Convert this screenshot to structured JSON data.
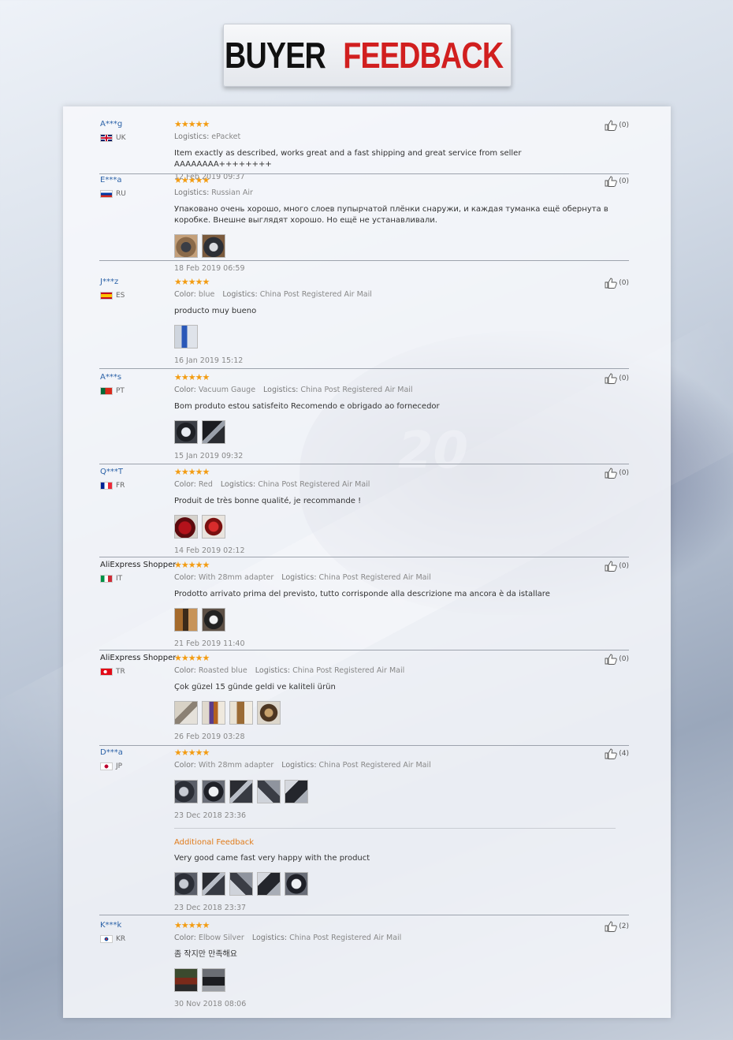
{
  "banner": {
    "word1": "BUYER",
    "word2": "FEEDBACK"
  },
  "reviews": [
    {
      "user": "A***g",
      "country": "UK",
      "stars": "★★★★★",
      "meta": [
        {
          "k": "Logistics:",
          "v": "ePacket"
        }
      ],
      "text": "Item exactly as described, works great and a fast shipping and great service from seller AAAAAAAA++++++++",
      "date": "12 Feb 2019 09:37",
      "helpful": "(0)"
    },
    {
      "user": "E***a",
      "country": "RU",
      "stars": "★★★★★",
      "meta": [
        {
          "k": "Logistics:",
          "v": "Russian Air"
        }
      ],
      "text": "Упаковано очень хорошо, много слоев пупырчатой плёнки снаружи, и каждая туманка ещё обернута в коробке. Внешне выглядят хорошо. Но ещё не устанавливали.",
      "date": "18 Feb 2019 06:59",
      "helpful": "(0)"
    },
    {
      "user": "J***z",
      "country": "ES",
      "stars": "★★★★★",
      "meta": [
        {
          "k": "Color:",
          "v": "blue"
        },
        {
          "k": "Logistics:",
          "v": "China Post Registered Air Mail"
        }
      ],
      "text": "producto muy bueno",
      "date": "16 Jan 2019 15:12",
      "helpful": "(0)"
    },
    {
      "user": "A***s",
      "country": "PT",
      "stars": "★★★★★",
      "meta": [
        {
          "k": "Color:",
          "v": "Vacuum Gauge"
        },
        {
          "k": "Logistics:",
          "v": "China Post Registered Air Mail"
        }
      ],
      "text": "Bom produto estou satisfeito Recomendo e obrigado ao fornecedor",
      "date": "15 Jan 2019 09:32",
      "helpful": "(0)"
    },
    {
      "user": "Q***T",
      "country": "FR",
      "stars": "★★★★★",
      "meta": [
        {
          "k": "Color:",
          "v": "Red"
        },
        {
          "k": "Logistics:",
          "v": "China Post Registered Air Mail"
        }
      ],
      "text": "Produit de très bonne qualité, je recommande !",
      "date": "14 Feb 2019 02:12",
      "helpful": "(0)"
    },
    {
      "user": "AliExpress Shopper",
      "country": "IT",
      "stars": "★★★★★",
      "meta": [
        {
          "k": "Color:",
          "v": "With 28mm adapter"
        },
        {
          "k": "Logistics:",
          "v": "China Post Registered Air Mail"
        }
      ],
      "text": "Prodotto arrivato prima del previsto, tutto corrisponde alla descrizione ma ancora è da istallare",
      "date": "21 Feb 2019 11:40",
      "helpful": "(0)"
    },
    {
      "user": "AliExpress Shopper",
      "country": "TR",
      "stars": "★★★★★",
      "meta": [
        {
          "k": "Color:",
          "v": "Roasted blue"
        },
        {
          "k": "Logistics:",
          "v": "China Post Registered Air Mail"
        }
      ],
      "text": "Çok güzel 15 günde geldi ve kaliteli ürün",
      "date": "26 Feb 2019 03:28",
      "helpful": "(0)"
    },
    {
      "user": "D***a",
      "country": "JP",
      "stars": "★★★★★",
      "meta": [
        {
          "k": "Color:",
          "v": "With 28mm adapter"
        },
        {
          "k": "Logistics:",
          "v": "China Post Registered Air Mail"
        }
      ],
      "date": "23 Dec 2018 23:36",
      "helpful": "(4)",
      "additional": {
        "label": "Additional Feedback",
        "text": "Very good came fast very happy with the product",
        "date": "23 Dec 2018 23:37"
      }
    },
    {
      "user": "K***k",
      "country": "KR",
      "stars": "★★★★★",
      "meta": [
        {
          "k": "Color:",
          "v": "Elbow Silver"
        },
        {
          "k": "Logistics:",
          "v": "China Post Registered Air Mail"
        }
      ],
      "text": "좀 작지만 만족해요",
      "date": "30 Nov 2018 08:06",
      "helpful": "(2)"
    }
  ]
}
